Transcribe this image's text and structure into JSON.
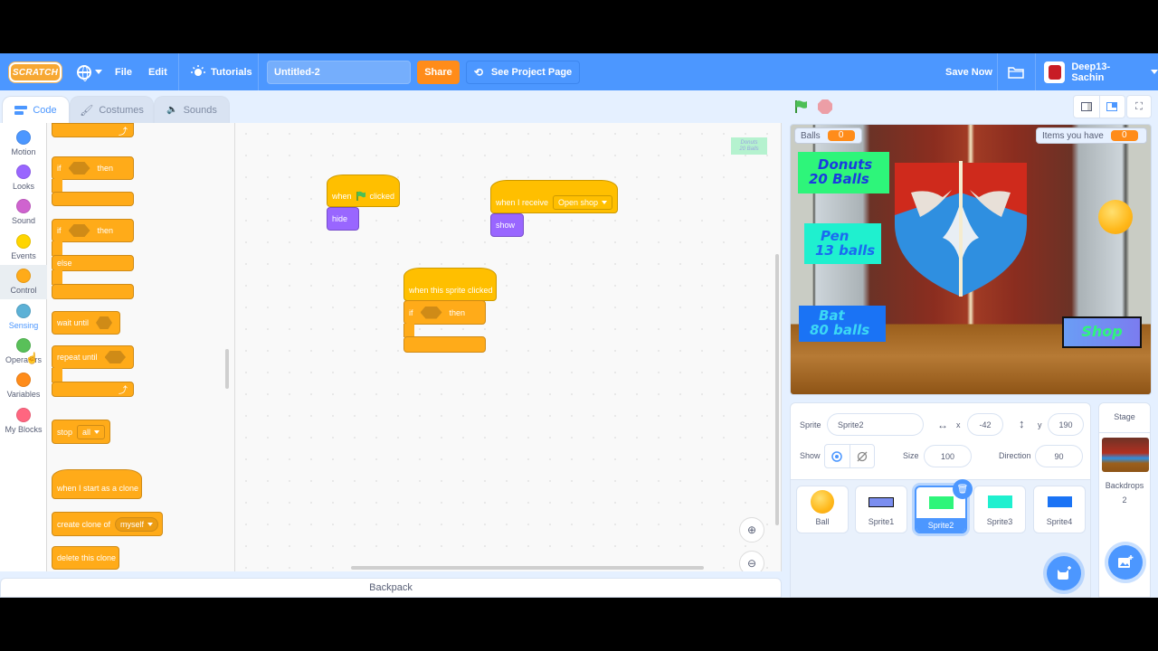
{
  "menubar": {
    "logo": "SCRATCH",
    "file": "File",
    "edit": "Edit",
    "tutorials": "Tutorials",
    "project_title": "Untitled-2",
    "share": "Share",
    "see_project_page": "See Project Page",
    "save_now": "Save Now",
    "username": "Deep13-Sachin"
  },
  "tabs": [
    {
      "label": "Code",
      "active": true
    },
    {
      "label": "Costumes",
      "active": false
    },
    {
      "label": "Sounds",
      "active": false
    }
  ],
  "categories": [
    {
      "label": "Motion",
      "color": "#4c97ff"
    },
    {
      "label": "Looks",
      "color": "#9966ff"
    },
    {
      "label": "Sound",
      "color": "#cf63cf"
    },
    {
      "label": "Events",
      "color": "#ffd500"
    },
    {
      "label": "Control",
      "color": "#ffab19"
    },
    {
      "label": "Sensing",
      "color": "#5cb1d6"
    },
    {
      "label": "Operators",
      "color": "#59c059"
    },
    {
      "label": "Variables",
      "color": "#ff8c1a"
    },
    {
      "label": "My Blocks",
      "color": "#ff6680"
    }
  ],
  "palette": {
    "if_then": {
      "if": "if",
      "then": "then"
    },
    "if_else": {
      "if": "if",
      "then": "then",
      "else": "else"
    },
    "wait_until": "wait until",
    "repeat_until": "repeat until",
    "stop": {
      "label": "stop",
      "option": "all"
    },
    "when_clone": "when I start as a clone",
    "create_clone": {
      "label": "create clone of",
      "option": "myself"
    },
    "delete_clone": "delete this clone"
  },
  "workspace": {
    "script1": {
      "when": "when",
      "clicked": "clicked",
      "action": "hide"
    },
    "script2": {
      "label": "when I receive",
      "message": "Open shop",
      "action": "show"
    },
    "script3": {
      "label": "when this sprite clicked",
      "if": "if",
      "then": "then"
    },
    "preview_sprite": {
      "line1": "Donuts",
      "line2": "20 Balls"
    }
  },
  "backpack": "Backpack",
  "stage": {
    "monitors": [
      {
        "label": "Balls",
        "value": "0"
      },
      {
        "label": "Items you have",
        "value": "0"
      }
    ],
    "signs": [
      {
        "line1": "Donuts",
        "line2": "20 Balls"
      },
      {
        "line1": "Pen",
        "line2": "13 balls"
      },
      {
        "line1": "Bat",
        "line2": "80 balls"
      },
      {
        "line1": "Shop",
        "line2": ""
      }
    ]
  },
  "sprite_info": {
    "sprite_label": "Sprite",
    "sprite_name": "Sprite2",
    "x_label": "x",
    "x": "-42",
    "y_label": "y",
    "y": "190",
    "show_label": "Show",
    "size_label": "Size",
    "size": "100",
    "direction_label": "Direction",
    "direction": "90"
  },
  "sprites": [
    {
      "name": "Ball",
      "selected": false
    },
    {
      "name": "Sprite1",
      "selected": false
    },
    {
      "name": "Sprite2",
      "selected": true
    },
    {
      "name": "Sprite3",
      "selected": false
    },
    {
      "name": "Sprite4",
      "selected": false
    }
  ],
  "stage_panel": {
    "title": "Stage",
    "backdrops_label": "Backdrops",
    "backdrops_count": "2"
  }
}
